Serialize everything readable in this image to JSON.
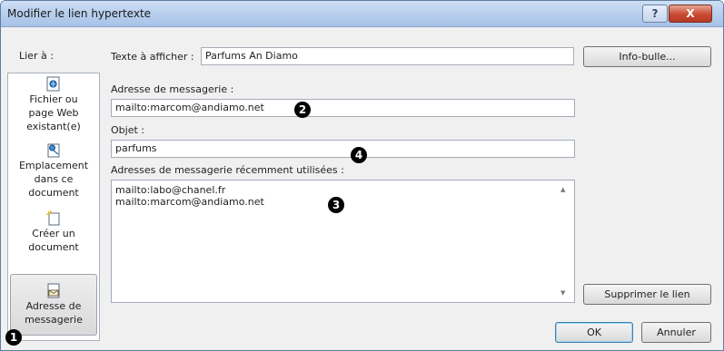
{
  "window": {
    "title": "Modifier le lien hypertexte",
    "help_glyph": "?",
    "close_glyph": "X"
  },
  "sidebar": {
    "label": "Lier à :",
    "items": [
      {
        "line1": "Fichier ou",
        "line2": "page Web",
        "line3": "existant(e)",
        "icon": "web-page-icon"
      },
      {
        "line1": "Emplacement",
        "line2": "dans ce",
        "line3": "document",
        "icon": "document-location-icon"
      },
      {
        "line1": "Créer un",
        "line2": "document",
        "icon": "new-document-icon"
      },
      {
        "line1": "Adresse de",
        "line2": "messagerie",
        "icon": "email-address-icon",
        "selected": true
      }
    ]
  },
  "display_text": {
    "label": "Texte à afficher :",
    "value": "Parfums An Diamo"
  },
  "screentip_button": "Info-bulle...",
  "email_address": {
    "label": "Adresse de messagerie :",
    "value": "mailto:marcom@andiamo.net"
  },
  "subject": {
    "label": "Objet :",
    "value": "parfums"
  },
  "recent": {
    "label": "Adresses de messagerie récemment utilisées :",
    "items": [
      "mailto:labo@chanel.fr",
      "mailto:marcom@andiamo.net"
    ]
  },
  "remove_link_button": "Supprimer le lien",
  "ok_button": "OK",
  "cancel_button": "Annuler",
  "markers": [
    "1",
    "2",
    "3",
    "4"
  ],
  "colors": {
    "titlebar": "#b9d0ee",
    "close_button": "#c94a33",
    "dialog_bg": "#f0f0f0"
  }
}
